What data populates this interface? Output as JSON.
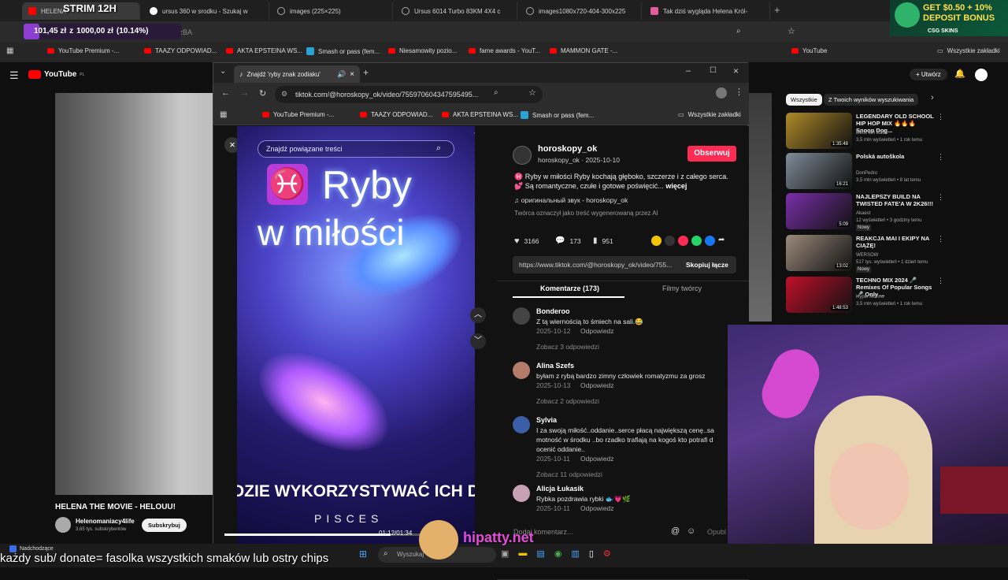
{
  "outer_browser": {
    "tabs": [
      {
        "label": "HELENA",
        "icon": "youtube-icon"
      },
      {
        "label": "ursus 360 w srodku - Szukaj w",
        "icon": "google-icon"
      },
      {
        "label": "images (225×225)",
        "icon": "globe-icon"
      },
      {
        "label": "Ursus 6014 Turbo 83KM 4X4 c",
        "icon": "globe-icon"
      },
      {
        "label": "images1080x720-404-300x225",
        "icon": "globe-icon"
      },
      {
        "label": "Tak dziś wygląda Helena Król-",
        "icon": "pink-page-icon"
      }
    ],
    "address_fragment": "Bkl0zBA",
    "bookmarks": [
      "YouTube Premium -...",
      "TAAZY ODPOWIAD...",
      "AKTA EPSTEINA WS...",
      "Smash or pass (fem...",
      "Niesamowity pozio...",
      "fame awards - YouT...",
      "MAMMON GATE -..."
    ],
    "bookmarks_right": "YouTube",
    "all_bookmarks": "Wszystkie zakładki"
  },
  "stream_overlay": {
    "title": "STRIM 12H",
    "amount": "101,45 zł",
    "of_label": "z",
    "goal": "1000,00 zł",
    "percent": "(10.14%)",
    "progress_fraction": 0.1014,
    "ad_line1": "GET $0.50 + 10%",
    "ad_line2": "DEPOSIT BONUS",
    "ad_brand": "CSG SKINS",
    "watermark": "hipatty.net",
    "ticker": "każdy sub/ donate= fasolka wszystkich smaków lub ostry chips"
  },
  "youtube": {
    "logo": "YouTube",
    "region": "PL",
    "create_label": "Utwórz",
    "video_title": "HELENA THE MOVIE - HELOUU!",
    "channel_name": "Helenomaniacy4life",
    "subscribers": "3,65 tys. subskrybentów",
    "subscribe_label": "Subskrybuj",
    "chips": [
      "Wszystkie",
      "Z Twoich wyników wyszukiwania"
    ],
    "related": [
      {
        "title": "LEGENDARY OLD SCHOOL HIP HOP MIX 🔥🔥🔥 Snoop Dog...",
        "channel": "Deus em Casa",
        "meta": "3,5 mln wyświetleń • 1 rok temu",
        "duration": "1:35:48",
        "badge": "",
        "color": "#b08a2a"
      },
      {
        "title": "Polská autoškola",
        "channel": "DonPedro",
        "meta": "3,5 mln wyświetleń • 8 lat temu",
        "duration": "16:21",
        "badge": "",
        "color": "#7f8c99"
      },
      {
        "title": "NAJLEPSZY BUILD NA TWISTED FATE'A W 2K26!!!",
        "channel": "Akaest",
        "meta": "12 wyświetleń • 3 godziny temu",
        "duration": "5:09",
        "badge": "Nowy",
        "color": "#7a2fa8"
      },
      {
        "title": "REAKCJA MAI I EKIPY NA CIĄŻĘ!",
        "channel": "WERSOW",
        "meta": "517 tys. wyświetleń • 1 dzień temu",
        "duration": "13:02",
        "badge": "Nowy",
        "color": "#9b8a7a"
      },
      {
        "title": "TECHNO MIX 2024 🎤 Remixes Of Popular Songs 🎤 Only ...",
        "channel": "HyperTechno",
        "meta": "3,5 mln wyświetleń • 1 rok temu",
        "duration": "1:48:53",
        "badge": "",
        "color": "#c0102a"
      }
    ]
  },
  "tiktok_window": {
    "tab_title": "Znajdź 'ryby znak zodiaku'",
    "url": "tiktok.com/@horoskopy_ok/video/755970604347595495...",
    "bookmarks": [
      "YouTube Premium -...",
      "TAAZY ODPOWIAD...",
      "AKTA EPSTEINA WS...",
      "Smash or pass (fem..."
    ],
    "all_bookmarks": "Wszystkie zakładki",
    "video": {
      "search_placeholder": "Znajdź powiązane treści",
      "sign": "♓",
      "headline1": "Ryby",
      "headline2": "w miłości",
      "caption": "DZIE WYKORZYSTYWAĆ ICH DOBRO",
      "sign_label": "PISCES",
      "time": "01:12/01:34",
      "progress_fraction": 0.766
    },
    "author": {
      "handle": "horoskopy_ok",
      "subline": "horoskopy_ok · 2025-10-10",
      "follow_label": "Obserwuj",
      "description": "♓ Ryby w miłości Ryby kochają głęboko, szczerze i z całego serca. 💕 Są romantyczne, czułe i gotowe poświęcić...",
      "more_label": "więcej",
      "sound": "оригинальный звук - horoskopy_ok",
      "ai_note": "Twórca oznaczył jako treść wygenerowaną przez AI"
    },
    "stats": {
      "likes": "3166",
      "comments": "173",
      "saves": "951"
    },
    "share_url": "https://www.tiktok.com/@horoskopy_ok/video/755...",
    "copy_label": "Skopiuj łącze",
    "tabs": [
      "Komentarze (173)",
      "Filmy twórcy"
    ],
    "comments": [
      {
        "user": "Bonderoo",
        "text": "Z tą wiernością to śmiech na sali.😂",
        "date": "2025-10-12",
        "reply": "Odpowiedz",
        "more": "Zobacz 3 odpowiedzi"
      },
      {
        "user": "Alina Szefs",
        "text": "byłam z rybą bardzo zimny człowiek romatyzmu za grosz",
        "date": "2025-10-13",
        "reply": "Odpowiedz",
        "more": "Zobacz 2 odpowiedzi"
      },
      {
        "user": "Sylvia",
        "text": "I za swoją miłość..oddanie..serce płacą największą cenę..sa motność w środku ..bo rzadko trafiają na kogoś kto potrafi d ocenić oddanie..",
        "date": "2025-10-11",
        "reply": "Odpowiedz",
        "more": "Zobacz 11 odpowiedzi"
      },
      {
        "user": "Alicja Łukasik",
        "text": "Rybka pozdrawia rybki 🐟💗🌿",
        "date": "2025-10-11",
        "reply": "Odpowiedz",
        "more": ""
      }
    ],
    "comment_placeholder": "Dodaj komentarz...",
    "publish_label": "Opubl"
  },
  "taskbar": {
    "notice": "Nadchodzące",
    "search_placeholder": "Wyszukaj"
  },
  "colors": {
    "accent": "#fe2c55",
    "youtube_red": "#ff0000",
    "progress_purple": "#8a3fd1"
  }
}
